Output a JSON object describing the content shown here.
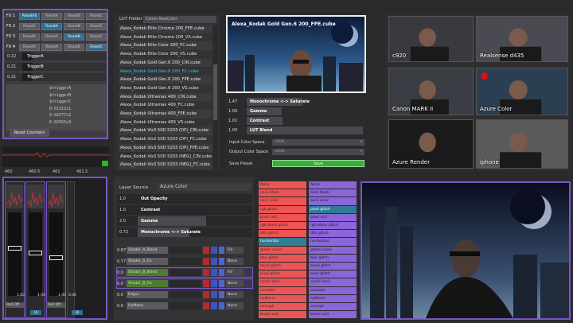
{
  "fx_panel": {
    "rows": [
      {
        "label": "FX 1",
        "buttons": [
          "ResetAll",
          "ResetA",
          "ResetB",
          "ResetC"
        ],
        "active": 0
      },
      {
        "label": "FX 2",
        "buttons": [
          "ResetA",
          "ResetA",
          "ResetB",
          "ResetC"
        ],
        "active": 1
      },
      {
        "label": "FX 3",
        "buttons": [
          "ResetA",
          "ResetA",
          "ResetB",
          "ResetC"
        ],
        "active": 2
      },
      {
        "label": "FX 4",
        "buttons": [
          "ResetA",
          "ResetA",
          "ResetB",
          "ResetC"
        ],
        "active": 3
      }
    ],
    "triggers": [
      {
        "value": "0.22",
        "label": "TriggerA"
      },
      {
        "value": "0.21",
        "label": "TriggerB"
      },
      {
        "value": "0.21",
        "label": "TriggerC"
      }
    ],
    "readouts": [
      "$triggerA",
      "$triggerB",
      "$triggerC",
      "0.01312x1",
      "0.02577x2",
      "0.02563x3"
    ],
    "reset_counters": "Reset Counters",
    "timeline_ticks": [
      "460",
      "460.5",
      "461",
      "461.5"
    ]
  },
  "mixer": {
    "channel_values": [
      "1.00",
      "1.00",
      "1.00",
      "0.46"
    ],
    "roll_off": [
      "Roll Off",
      "Roll Off"
    ],
    "ui_badge": "UI",
    "small_labels": [
      "-1.0",
      "1.0"
    ]
  },
  "lut_panel": {
    "header_label": "LUT Folder",
    "folder_value": "Canon RawColor",
    "items": [
      "Alexa_Kodak Elite Chrome 200_FPE.cube",
      "Alexa_Kodak Elite Chrome 200_VS.cube",
      "Alexa_Kodak Elite Color 200_FC.cube",
      "Alexa_Kodak Elite Color 200_VS.cube",
      "Alexa_Kodak Gold Gen.6 200_CIN.cube",
      "Alexa_Kodak Gold Gen.6 200_FC.cube",
      "Alexa_Kodak Gold Gen.6 200_FPE.cube",
      "Alexa_Kodak Gold Gen.6 200_VS.cube",
      "Alexa_Kodak Ultramax 400_CIN.cube",
      "Alexa_Kodak Ultramax 400_FC.cube",
      "Alexa_Kodak Ultramax 400_FPE.cube",
      "Alexa_Kodak Ultramax 400_VS.cube",
      "Alexa_Kodak Vis3 50D 5203 (DP)_CIN.cube",
      "Alexa_Kodak Vis3 50D 5203 (DP)_FC.cube",
      "Alexa_Kodak Vis3 50D 5203 (DP)_FPE.cube",
      "Alexa_Kodak Vis3 50D 5203 (NEG)_CIN.cube",
      "Alexa_Kodak Vis3 50D 5203 (NEG)_FC.cube"
    ],
    "selected_index": 5
  },
  "preview": {
    "title": "Alexa_Kodak Gold Gen.6 200_FPE.cube",
    "params": [
      {
        "value": "1.47",
        "label": "Monochrome <-> Saturate",
        "fill": 0.48
      },
      {
        "value": "1.00",
        "label": "Gamma",
        "fill": 0.3
      },
      {
        "value": "1.01",
        "label": "Contrast",
        "fill": 0.31
      },
      {
        "value": "1.00",
        "label": "LUT Blend",
        "fill": 1.0
      }
    ],
    "input_color_space_label": "Input Color Space",
    "input_color_space_value": "sRGB",
    "output_color_space_label": "Output Color Space",
    "output_color_space_value": "sRGB",
    "save_preset_label": "Save Preset",
    "save_button": "Save"
  },
  "cameras": [
    {
      "label": "c920"
    },
    {
      "label": "Realsense d435"
    },
    {
      "label": "Canon MARK II"
    },
    {
      "label": "Azure Color"
    },
    {
      "label": "Azure Render"
    },
    {
      "label": "iphone"
    }
  ],
  "layer_panel": {
    "source_label": "Layer Source",
    "source_value": "Azure Color",
    "params": [
      {
        "value": "1.0",
        "label": "Out Opacity",
        "fill": 0.0
      },
      {
        "value": "1.0",
        "label": "Contrast",
        "fill": 0.0
      },
      {
        "value": "2.0",
        "label": "Gamma",
        "fill": 0.6
      },
      {
        "value": "0.72",
        "label": "Monochrome <-> Saturate",
        "fill": 0.45
      }
    ],
    "layers": [
      {
        "value": "0.87",
        "name": "Shader_A_Blend",
        "mode": "Fill"
      },
      {
        "value": "0.77",
        "name": "Shader_A_Fix",
        "mode": "None"
      },
      {
        "value": "0.0",
        "name": "Shader_B_Blend",
        "mode": "Fill"
      },
      {
        "value": "0.0",
        "name": "Shader_B_Fix",
        "mode": "None"
      },
      {
        "value": "0.0",
        "name": "Edges",
        "mode": "None"
      },
      {
        "value": "0.0",
        "name": "Halftone",
        "mode": "None"
      }
    ]
  },
  "shader_lists": {
    "red": [
      "None",
      "ascii black",
      "ascii color",
      "rgb glitch",
      "pixel sort",
      "rgb block glitch",
      "dits glitch",
      "horizontal",
      "green noise",
      "blur glitch",
      "band glitch",
      "pixel glitch",
      "cyclic ascii",
      "pixelate",
      "halftone",
      "corrupt",
      "broke sort"
    ],
    "purple": [
      "None",
      "ascii black",
      "ascii color",
      "pixel glitch",
      "pixel sort",
      "rgb block glitch",
      "dits glitch",
      "horizontal",
      "green noise",
      "blur glitch",
      "band glitch",
      "pixel glitch",
      "cyclic ascii",
      "pixelate",
      "halftone",
      "corrupt",
      "broke sort"
    ],
    "red_selected": 7,
    "purple_selected": 3
  },
  "colors": {
    "accent_purple": "#7a56c8",
    "accent_blue": "#2e6f95",
    "save_green": "#3fa83f",
    "shader_red": "#ec5555",
    "shader_purple": "#8a66d8"
  }
}
